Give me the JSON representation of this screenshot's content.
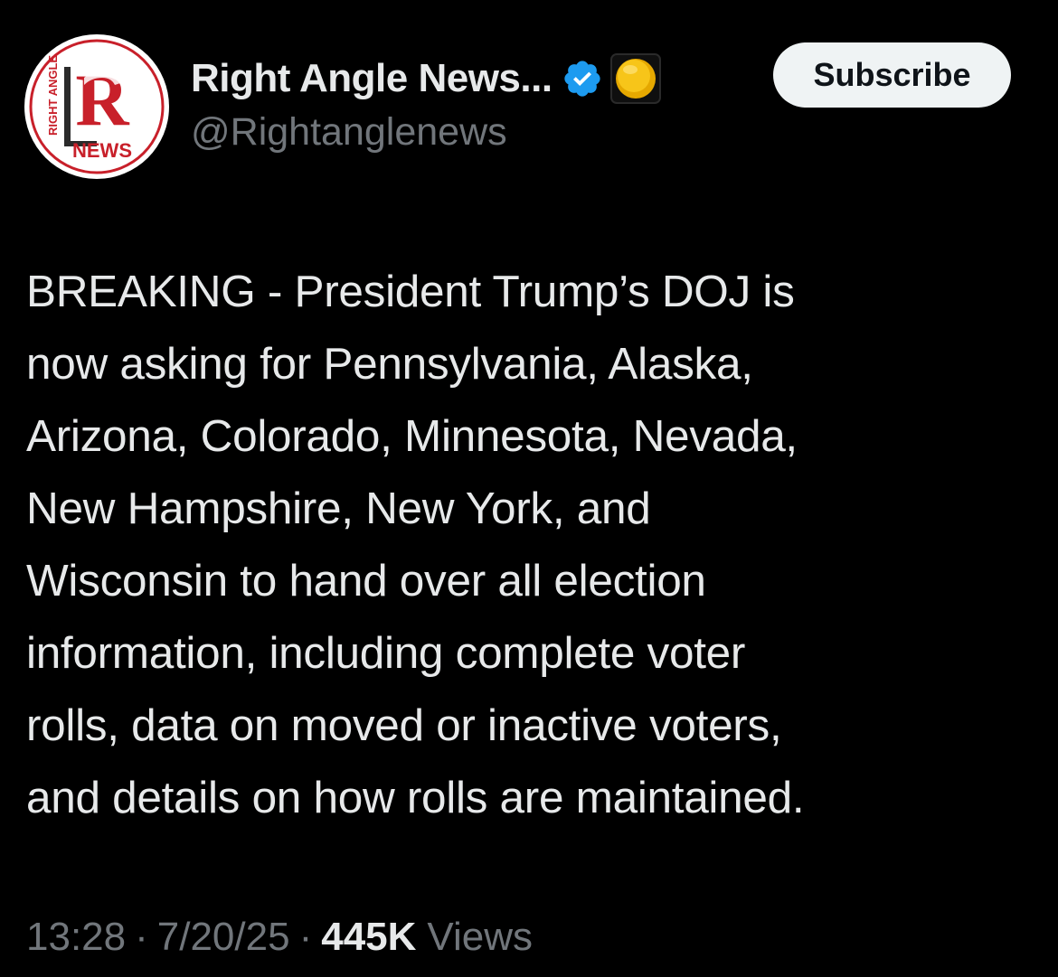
{
  "author": {
    "display_name": "Right Angle News...",
    "handle": "@Rightanglenews",
    "avatar_icon": "right-angle-news-logo",
    "avatar_logo_text": {
      "top": "RIGHT ANGLE",
      "bottom": "NEWS",
      "letter": "R"
    },
    "verified_icon": "verified-badge-icon",
    "affiliate_badge_icon": "yellow-circle-badge-icon",
    "colors": {
      "verified": "#1d9bf0",
      "logo_red": "#c8202a",
      "affiliate": "#f5c518"
    }
  },
  "subscribe_button": {
    "label": "Subscribe"
  },
  "tweet": {
    "text": "BREAKING - President Trump’s DOJ is\nnow asking for Pennsylvania, Alaska,\nArizona, Colorado, Minnesota, Nevada,\nNew Hampshire, New York, and\nWisconsin to hand over all election\ninformation, including complete voter\nrolls, data on moved or inactive voters,\nand details on how rolls are maintained."
  },
  "meta": {
    "time": "13:28",
    "separator": "·",
    "date": "7/20/25",
    "views_count": "445K",
    "views_label": "Views"
  }
}
